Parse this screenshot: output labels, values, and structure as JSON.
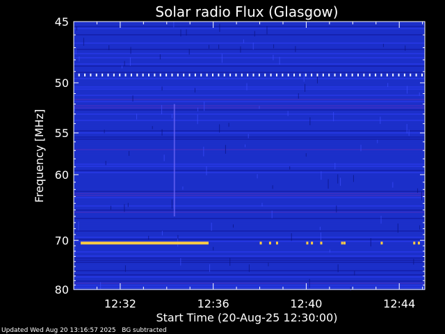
{
  "chart_data": {
    "type": "heatmap",
    "title": "Solar radio Flux (Glasgow)",
    "xlabel": "Start Time (20-Aug-25 12:30:00)",
    "ylabel": "Frequency [MHz]",
    "x_unit": "minutes after 12:30:00",
    "xlim": [
      0,
      15.1
    ],
    "ylim": [
      45,
      80
    ],
    "y_ticks": [
      {
        "value": 45,
        "label": "45"
      },
      {
        "value": 50,
        "label": "50"
      },
      {
        "value": 55,
        "label": "55"
      },
      {
        "value": 60,
        "label": "60"
      },
      {
        "value": 70,
        "label": "70"
      },
      {
        "value": 80,
        "label": "80"
      }
    ],
    "x_ticks": [
      {
        "value": 2,
        "label": "12:32"
      },
      {
        "value": 6,
        "label": "12:36"
      },
      {
        "value": 10,
        "label": "12:40"
      },
      {
        "value": 14,
        "label": "12:44"
      }
    ],
    "features": [
      {
        "kind": "continuous interference band",
        "frequency_mhz": 70.5,
        "t_start": 0.3,
        "t_end": 5.8,
        "color": "#ffcc44"
      },
      {
        "kind": "dotted interference line",
        "frequency_mhz": 49.3,
        "t_start": 0.2,
        "t_end": 15.0,
        "color": "#ffffff"
      },
      {
        "kind": "faint vertical streak",
        "frequency_mhz_range": [
          52,
          66
        ],
        "t": 4.3,
        "color": "#7a6fff"
      }
    ],
    "colors": {
      "background": "#000000",
      "plot_base": "#1c2fc9",
      "plot_dark": "#10189a",
      "band": "#ffcc44",
      "tick": "#ffffff"
    }
  },
  "footer": {
    "updated": "Updated Wed Aug 20 13:16:57 2025",
    "note": "BG subtracted"
  }
}
